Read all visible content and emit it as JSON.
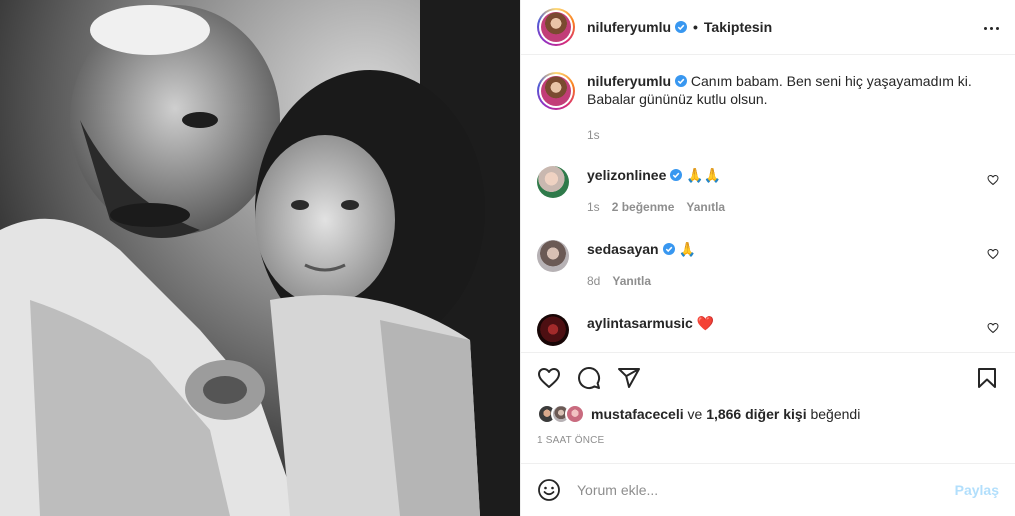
{
  "post": {
    "username": "niluferyumlu",
    "separator": "•",
    "follow_status": "Takiptesin"
  },
  "caption": {
    "username": "niluferyumlu",
    "text": "Canım babam. Ben seni hiç yaşayamadım ki. Babalar gününüz kutlu olsun.",
    "time": "1s"
  },
  "comments": [
    {
      "username": "yelizonlinee",
      "text": "🙏🙏",
      "time": "1s",
      "likes": "2 beğenme",
      "reply": "Yanıtla"
    },
    {
      "username": "sedasayan",
      "text": "🙏",
      "time": "8d",
      "reply": "Yanıtla"
    },
    {
      "username": "aylintasarmusic",
      "text": "❤️"
    }
  ],
  "likes": {
    "first_user": "mustafaceceli",
    "joiner": "ve",
    "others": "1,866 diğer kişi",
    "suffix": "beğendi"
  },
  "timestamp": "1 SAAT ÖNCE",
  "add_comment": {
    "placeholder": "Yorum ekle...",
    "post_label": "Paylaş"
  },
  "icons": {
    "verified": "verified-badge-icon",
    "more": "more-options-icon",
    "like": "heart-icon",
    "comment": "comment-icon",
    "share": "paper-plane-icon",
    "save": "bookmark-icon",
    "emoji": "emoji-icon"
  },
  "colors": {
    "verified_blue": "#3897f0",
    "link_disabled": "#b2dffc",
    "secondary_text": "#8e8e8e"
  }
}
